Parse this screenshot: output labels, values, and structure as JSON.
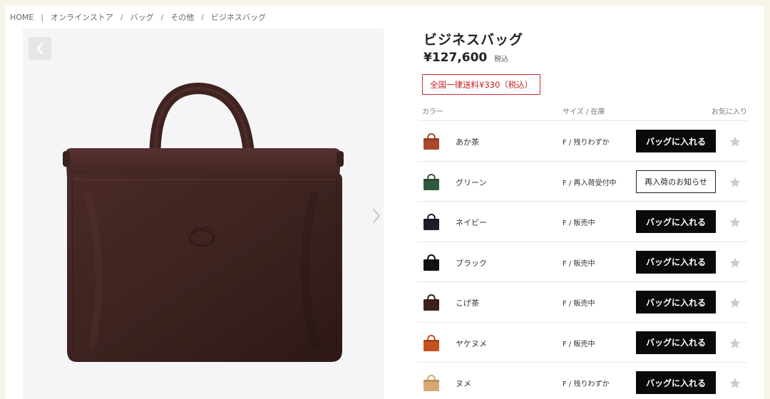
{
  "breadcrumb": {
    "items": [
      "HOME",
      "オンラインストア",
      "バッグ",
      "その他",
      "ビジネスバッグ"
    ],
    "sep_first": "|",
    "sep": "/"
  },
  "product": {
    "title": "ビジネスバッグ",
    "price": "¥127,600",
    "tax_label": "税込",
    "shipping": "全国一律送料¥330（税込）"
  },
  "table": {
    "col_color": "カラー",
    "col_size": "サイズ / 在庫",
    "col_fav": "お気に入り",
    "rows": [
      {
        "color": "あか茶",
        "stock": "F / 残りわずか",
        "action": "バッグに入れる",
        "type": "cart",
        "swatch": "#a84a2c"
      },
      {
        "color": "グリーン",
        "stock": "F / 再入荷受付中",
        "action": "再入荷のお知らせ",
        "type": "notify",
        "swatch": "#2f5a3c"
      },
      {
        "color": "ネイビー",
        "stock": "F / 販売中",
        "action": "バッグに入れる",
        "type": "cart",
        "swatch": "#1c1f26"
      },
      {
        "color": "ブラック",
        "stock": "F / 販売中",
        "action": "バッグに入れる",
        "type": "cart",
        "swatch": "#111111"
      },
      {
        "color": "こげ茶",
        "stock": "F / 販売中",
        "action": "バッグに入れる",
        "type": "cart",
        "swatch": "#3b2220"
      },
      {
        "color": "ヤケヌメ",
        "stock": "F / 販売中",
        "action": "バッグに入れる",
        "type": "cart",
        "swatch": "#c4521e"
      },
      {
        "color": "ヌメ",
        "stock": "F / 残りわずか",
        "action": "バッグに入れる",
        "type": "cart",
        "swatch": "#d7a874"
      }
    ]
  },
  "colors": {
    "accent_red": "#d02b2b",
    "button_black": "#0a0a0a",
    "star_gray": "#cccccc"
  },
  "icons": {
    "prev": "chevron-left-icon",
    "next": "chevron-right-icon",
    "fav": "star-icon"
  }
}
